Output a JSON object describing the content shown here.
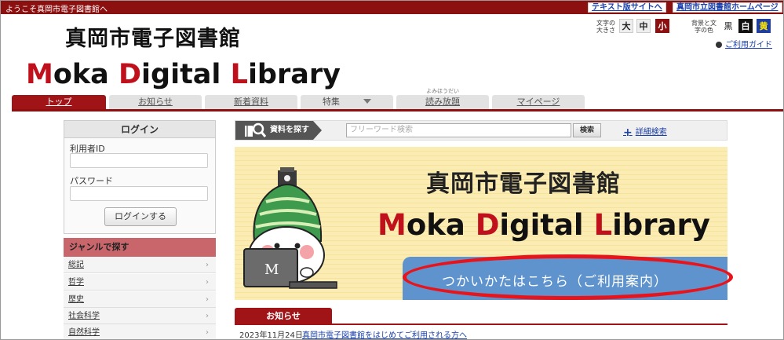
{
  "topbar": {
    "welcome": "ようこそ真岡市電子図書館へ",
    "text_site_link": "テキスト版サイトへ",
    "library_home_link": "真岡市立図書館ホームページ"
  },
  "header": {
    "logo_jp": "真岡市電子図書館",
    "logo_en_parts": [
      "M",
      "oka ",
      "D",
      "igital ",
      "L",
      "ibrary"
    ]
  },
  "controls": {
    "font_size_label": "文字の大きさ",
    "font_sizes": [
      "大",
      "中",
      "小"
    ],
    "color_label": "背景と文字の色",
    "colors": [
      "黒",
      "白",
      "黄"
    ],
    "guide_link": "ご利用ガイド"
  },
  "nav": {
    "tabs": [
      {
        "label": "トップ",
        "active": true
      },
      {
        "label": "お知らせ"
      },
      {
        "label": "新着資料"
      },
      {
        "label": "特集"
      },
      {
        "label": "読み放題",
        "ruby": "よみほうだい"
      },
      {
        "label": "マイページ"
      }
    ]
  },
  "login": {
    "title": "ログイン",
    "user_id_label": "利用者ID",
    "password_label": "パスワード",
    "button": "ログインする"
  },
  "genre": {
    "title": "ジャンルで探す",
    "items": [
      "総記",
      "哲学",
      "歴史",
      "社会科学",
      "自然科学"
    ]
  },
  "search": {
    "label": "資料を探す",
    "placeholder": "フリーワード検索",
    "button": "検索",
    "advanced": "詳細検索"
  },
  "banner": {
    "title_jp": "真岡市電子図書館",
    "title_en_parts": [
      "M",
      "oka ",
      "D",
      "igital ",
      "L",
      "ibrary"
    ],
    "button_text": "つかいかたはこちら（ご利用案内）"
  },
  "news": {
    "tab": "お知らせ",
    "items": [
      {
        "date": "2023年11月24日",
        "title": "真岡市電子図書館をはじめてご利用される方へ"
      }
    ]
  },
  "colors": {
    "brand_dark_red": "#8c1010",
    "accent_red": "#c0101c",
    "highlight_ring": "#e8141c",
    "banner_button_blue": "#5f93cd"
  }
}
